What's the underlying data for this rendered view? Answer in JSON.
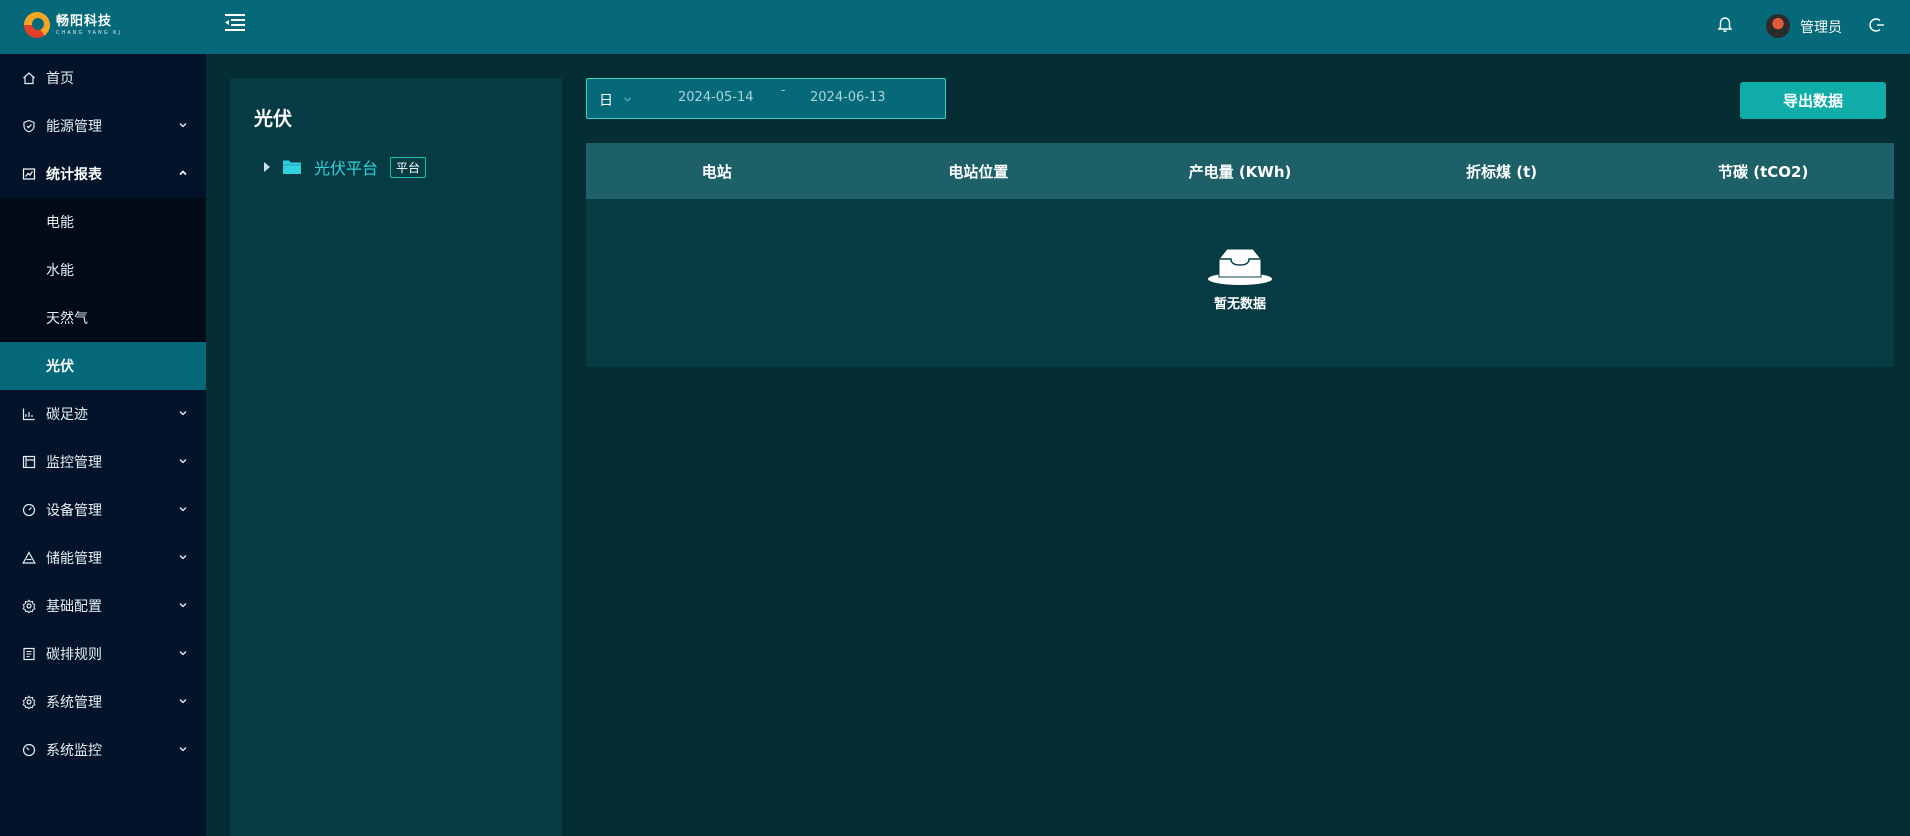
{
  "brand": {
    "name_cn": "畅阳科技",
    "name_en": "CHANG YANG KJ"
  },
  "header": {
    "username": "管理员"
  },
  "sidebar": {
    "items": [
      {
        "label": "首页",
        "icon": "home-icon",
        "expandable": false
      },
      {
        "label": "能源管理",
        "icon": "shield-icon",
        "expandable": true
      },
      {
        "label": "统计报表",
        "icon": "chart-icon",
        "expandable": true,
        "open": true,
        "children": [
          "电能",
          "水能",
          "天然气",
          "光伏"
        ],
        "active_child": "光伏"
      },
      {
        "label": "碳足迹",
        "icon": "bar-chart-icon",
        "expandable": true
      },
      {
        "label": "监控管理",
        "icon": "monitor-icon",
        "expandable": true
      },
      {
        "label": "设备管理",
        "icon": "gauge-icon",
        "expandable": true
      },
      {
        "label": "储能管理",
        "icon": "triangle-icon",
        "expandable": true
      },
      {
        "label": "基础配置",
        "icon": "settings-icon",
        "expandable": true
      },
      {
        "label": "碳排规则",
        "icon": "document-icon",
        "expandable": true
      },
      {
        "label": "系统管理",
        "icon": "gear-icon",
        "expandable": true
      },
      {
        "label": "系统监控",
        "icon": "dashboard-icon",
        "expandable": true
      }
    ]
  },
  "left_panel": {
    "title": "光伏",
    "tree": {
      "label": "光伏平台",
      "tag": "平台"
    }
  },
  "filter": {
    "range_type": "日",
    "start_date": "2024-05-14",
    "separator": "-",
    "end_date": "2024-06-13"
  },
  "actions": {
    "export_label": "导出数据"
  },
  "table": {
    "columns": [
      "电站",
      "电站位置",
      "产电量 (KWh)",
      "折标煤 (t)",
      "节碳 (tCO2)"
    ],
    "rows": [],
    "empty_text": "暂无数据"
  },
  "colors": {
    "header": "#05697a",
    "sidebar": "#03142a",
    "accent": "#10ada8",
    "tree_label": "#2ed3df"
  }
}
